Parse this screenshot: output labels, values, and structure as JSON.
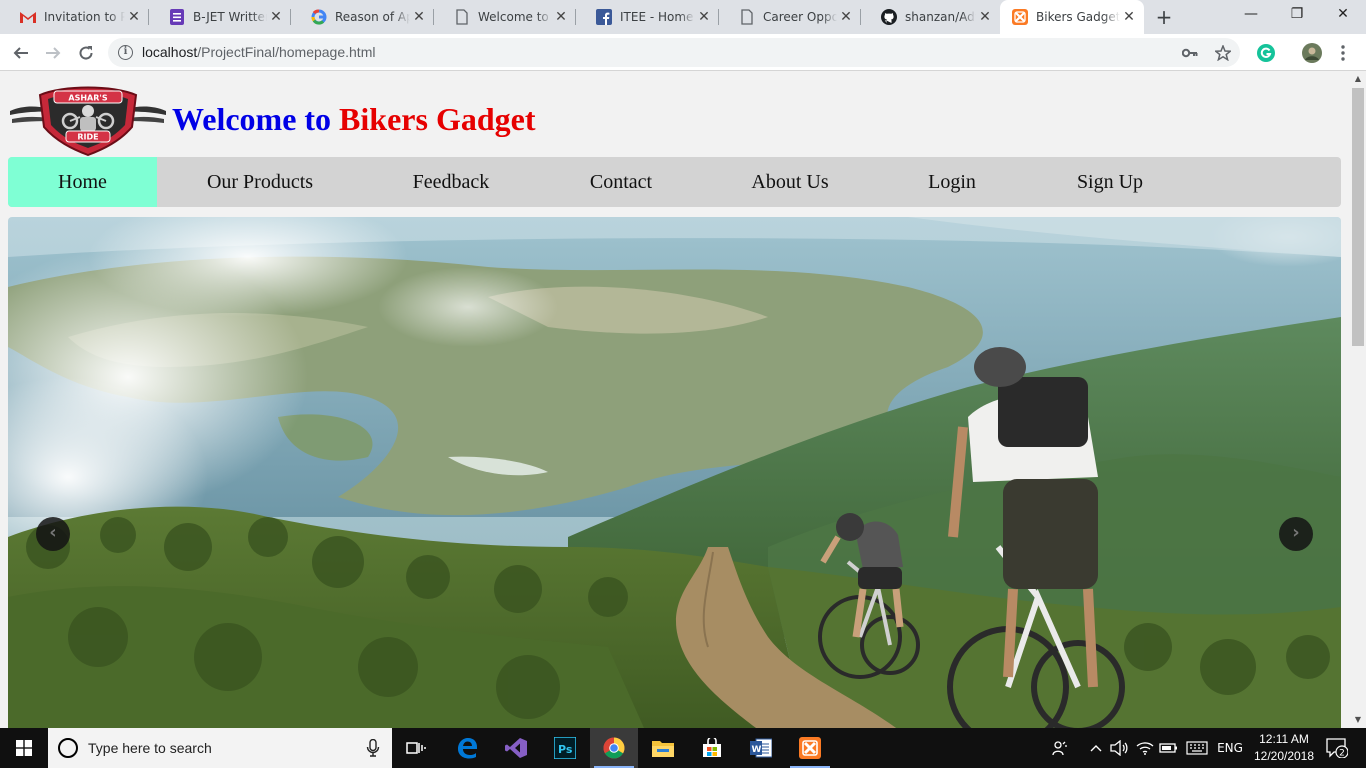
{
  "browser": {
    "tabs": [
      {
        "title": "Invitation to Pa",
        "icon": "gmail-icon",
        "active": false
      },
      {
        "title": "B-JET Written",
        "icon": "forms-icon",
        "active": false
      },
      {
        "title": "Reason of App",
        "icon": "google-icon",
        "active": false
      },
      {
        "title": "Welcome to B",
        "icon": "page-icon",
        "active": false
      },
      {
        "title": "ITEE - Home",
        "icon": "facebook-icon",
        "active": false
      },
      {
        "title": "Career Opport",
        "icon": "page-icon",
        "active": false
      },
      {
        "title": "shanzan/Advo",
        "icon": "github-icon",
        "active": false
      },
      {
        "title": "Bikers Gadget",
        "icon": "xampp-icon",
        "active": true
      }
    ],
    "new_tab": "+",
    "window_controls": {
      "minimize": "—",
      "maximize": "❐",
      "close": "✕"
    },
    "url_host": "localhost",
    "url_path": "/ProjectFinal/homepage.html"
  },
  "page": {
    "title_prefix": "Welcome to",
    "title_brand": "Bikers Gadget",
    "logo_text_top": "ASHAR'S",
    "logo_text_bottom": "RIDE",
    "menu": [
      {
        "label": "Home",
        "active": true
      },
      {
        "label": "Our Products",
        "active": false
      },
      {
        "label": "Feedback",
        "active": false
      },
      {
        "label": "Contact",
        "active": false
      },
      {
        "label": "About Us",
        "active": false
      },
      {
        "label": "Login",
        "active": false
      },
      {
        "label": "Sign Up",
        "active": false
      }
    ],
    "carousel": {
      "prev": "‹",
      "next": "›"
    },
    "colors": {
      "title_blue": "#0000e6",
      "title_red": "#e60000",
      "menu_active": "#7fffd4",
      "menu_bg": "#d3d3d3"
    }
  },
  "taskbar": {
    "search_placeholder": "Type here to search",
    "apps": [
      "task-view-icon",
      "edge-icon",
      "visual-studio-icon",
      "photoshop-icon",
      "chrome-icon",
      "file-explorer-icon",
      "store-icon",
      "word-icon",
      "xampp-icon"
    ],
    "language": "ENG",
    "time": "12:11 AM",
    "date": "12/20/2018",
    "notification_count": "2"
  }
}
